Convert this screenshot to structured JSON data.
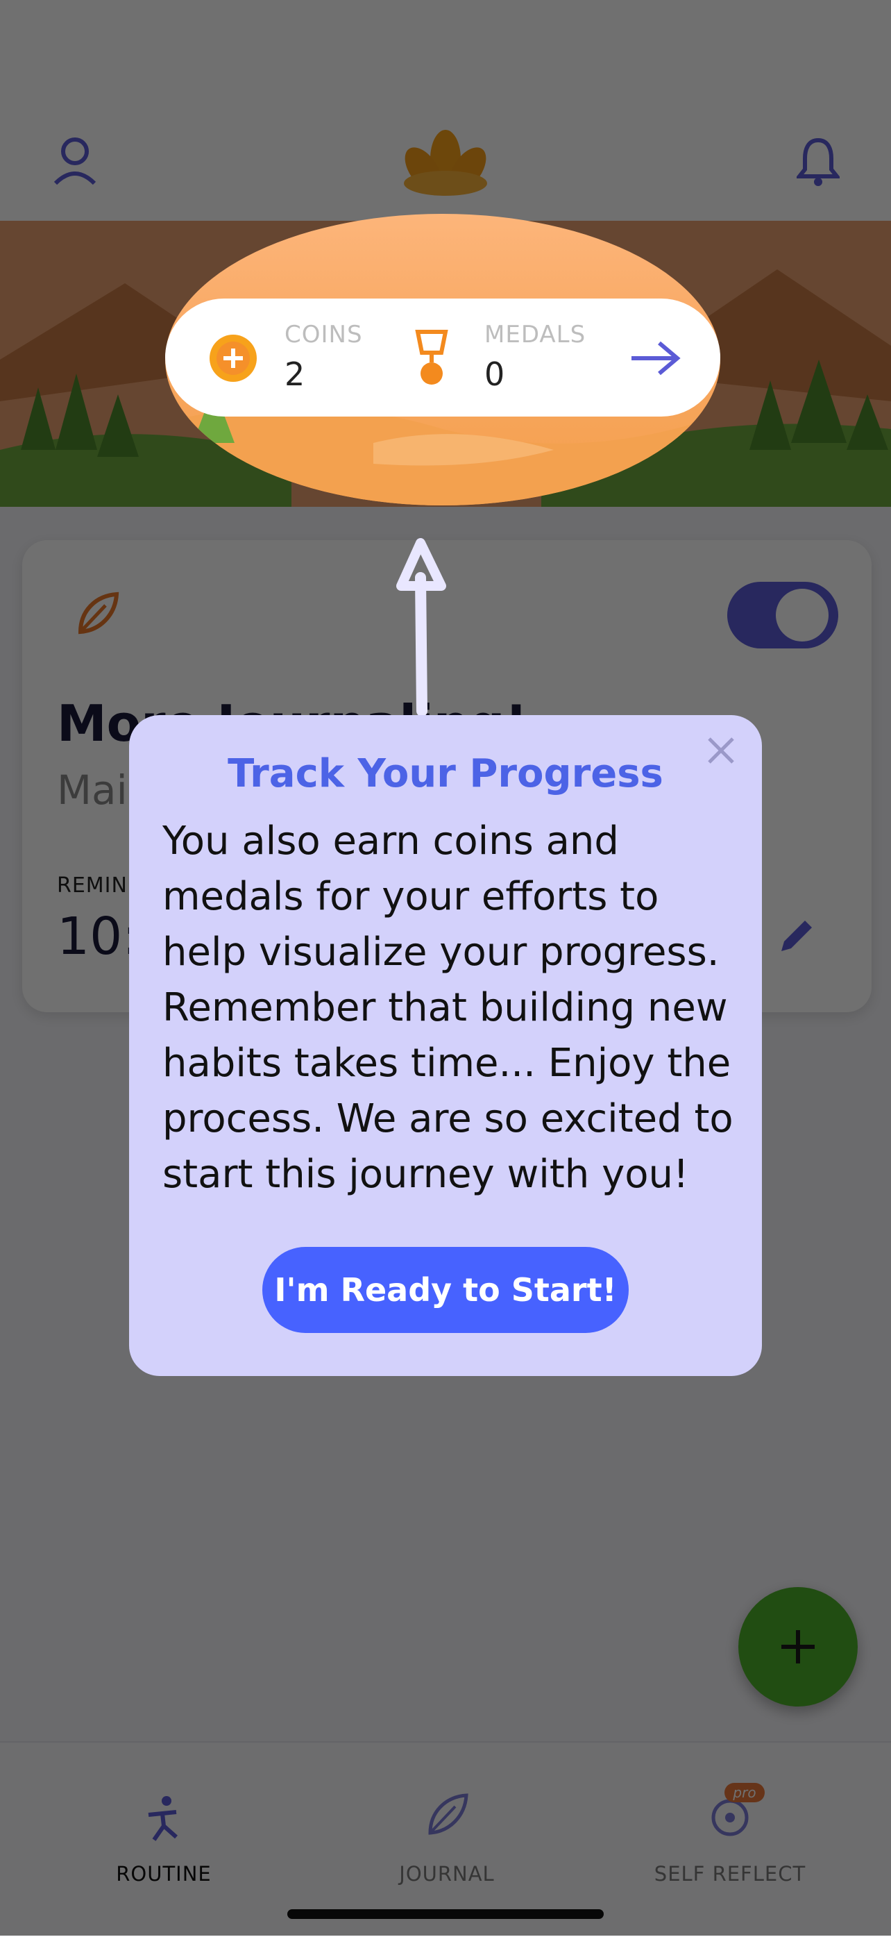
{
  "coins": {
    "label": "COINS",
    "value": "2"
  },
  "medals": {
    "label": "MEDALS",
    "value": "0"
  },
  "card": {
    "title": "More Journaling!",
    "subtitle": "Main",
    "reminder_label": "REMIN",
    "reminder_time": "10:4"
  },
  "popup": {
    "title": "Track Your Progress",
    "body": "You also earn coins and medals for your efforts to help visualize your progress. Remember that building new habits takes time... Enjoy the process. We are so excited to start this journey with you!",
    "button": "I'm Ready to Start!"
  },
  "nav": {
    "routine": "ROUTINE",
    "journal": "JOURNAL",
    "self_reflect": "SELF REFLECT",
    "pro_badge": "pro"
  },
  "colors": {
    "accent": "#4762ff",
    "popup_bg": "#d3d1fb",
    "fab": "#4caf2a",
    "coin": "#f7a21b"
  }
}
